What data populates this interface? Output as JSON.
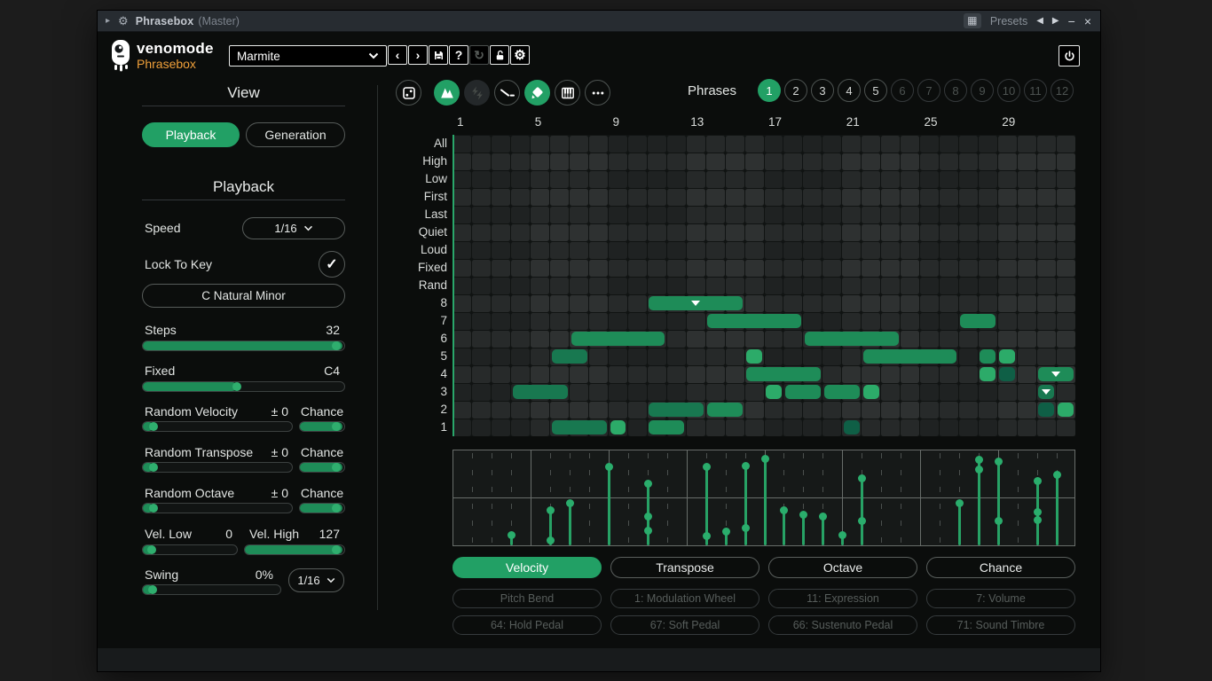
{
  "titlebar": {
    "title": "Phrasebox",
    "subtitle": "(Master)",
    "presets_label": "Presets"
  },
  "header": {
    "brand": "venomode",
    "product": "Phrasebox",
    "preset_name": "Marmite"
  },
  "icons": {
    "caret": "▸",
    "gear": "⚙",
    "grid": "▦",
    "prev": "◀",
    "next": "▶",
    "minimize": "−",
    "close": "×",
    "chev_left": "‹",
    "chev_right": "›",
    "help": "?",
    "reload": "↻",
    "check": "✓",
    "dots": "•••"
  },
  "sidebar": {
    "view_title": "View",
    "view_tabs": [
      {
        "label": "Playback",
        "active": true
      },
      {
        "label": "Generation",
        "active": false
      }
    ],
    "section_title": "Playback",
    "speed": {
      "label": "Speed",
      "value": "1/16"
    },
    "lock_label": "Lock To Key",
    "lock_checked": true,
    "key": "C Natural Minor",
    "steps": {
      "label": "Steps",
      "value": "32",
      "fill": 1.0
    },
    "fixed": {
      "label": "Fixed",
      "value": "C4",
      "fill": 0.47
    },
    "randoms": [
      {
        "label": "Random Velocity",
        "value": "± 0",
        "chance_label": "Chance",
        "fill": 0.03,
        "chance_fill": 1.0
      },
      {
        "label": "Random Transpose",
        "value": "± 0",
        "chance_label": "Chance",
        "fill": 0.03,
        "chance_fill": 1.0
      },
      {
        "label": "Random Octave",
        "value": "± 0",
        "chance_label": "Chance",
        "fill": 0.03,
        "chance_fill": 1.0
      }
    ],
    "vel_low": {
      "label": "Vel. Low",
      "value": "0",
      "fill": 0.03
    },
    "vel_high": {
      "label": "Vel. High",
      "value": "127",
      "fill": 1.0
    },
    "swing": {
      "label": "Swing",
      "value": "0%",
      "grid": "1/16",
      "fill": 0.03
    }
  },
  "toolbar_icons": [
    {
      "name": "dice-icon",
      "state": "outline"
    },
    {
      "name": "phrase-icon",
      "state": "green"
    },
    {
      "name": "bolt-cycle-icon",
      "state": "dark"
    },
    {
      "name": "glide-icon",
      "state": "outline"
    },
    {
      "name": "paint-bucket-icon",
      "state": "green"
    },
    {
      "name": "piano-icon",
      "state": "outline"
    },
    {
      "name": "more-icon",
      "state": "outline"
    }
  ],
  "phrases": {
    "label": "Phrases",
    "items": [
      {
        "n": "1",
        "state": "active"
      },
      {
        "n": "2",
        "state": "on"
      },
      {
        "n": "3",
        "state": "on"
      },
      {
        "n": "4",
        "state": "on"
      },
      {
        "n": "5",
        "state": "on"
      },
      {
        "n": "6",
        "state": "dim"
      },
      {
        "n": "7",
        "state": "dim"
      },
      {
        "n": "8",
        "state": "dim"
      },
      {
        "n": "9",
        "state": "dim"
      },
      {
        "n": "10",
        "state": "dim"
      },
      {
        "n": "11",
        "state": "dim"
      },
      {
        "n": "12",
        "state": "dim"
      }
    ]
  },
  "grid": {
    "col_numbers": [
      1,
      5,
      9,
      13,
      17,
      21,
      25,
      29
    ],
    "row_labels": [
      "All",
      "High",
      "Low",
      "First",
      "Last",
      "Quiet",
      "Loud",
      "Fixed",
      "Rand",
      "8",
      "7",
      "6",
      "5",
      "4",
      "3",
      "2",
      "1"
    ],
    "notes": [
      {
        "row": 8,
        "c1": 11,
        "c2": 15,
        "shade": "med",
        "marker": true
      },
      {
        "row": 7,
        "c1": 14,
        "c2": 18,
        "shade": "med"
      },
      {
        "row": 7,
        "c1": 27,
        "c2": 28,
        "shade": "med"
      },
      {
        "row": 6,
        "c1": 7,
        "c2": 11,
        "shade": "med"
      },
      {
        "row": 6,
        "c1": 19,
        "c2": 23,
        "shade": "med"
      },
      {
        "row": 5,
        "c1": 6,
        "c2": 7,
        "shade": "meddark"
      },
      {
        "row": 5,
        "c1": 16,
        "c2": 16,
        "shade": "bright"
      },
      {
        "row": 5,
        "c1": 22,
        "c2": 26,
        "shade": "med"
      },
      {
        "row": 5,
        "c1": 28,
        "c2": 28,
        "shade": "med"
      },
      {
        "row": 5,
        "c1": 29,
        "c2": 29,
        "shade": "bright"
      },
      {
        "row": 4,
        "c1": 16,
        "c2": 19,
        "shade": "med"
      },
      {
        "row": 4,
        "c1": 28,
        "c2": 28,
        "shade": "bright"
      },
      {
        "row": 4,
        "c1": 29,
        "c2": 29,
        "shade": "dark"
      },
      {
        "row": 4,
        "c1": 31,
        "c2": 32,
        "shade": "med",
        "marker": true
      },
      {
        "row": 3,
        "c1": 4,
        "c2": 6,
        "shade": "meddark"
      },
      {
        "row": 3,
        "c1": 17,
        "c2": 17,
        "shade": "bright"
      },
      {
        "row": 3,
        "c1": 18,
        "c2": 19,
        "shade": "med"
      },
      {
        "row": 3,
        "c1": 20,
        "c2": 21,
        "shade": "med"
      },
      {
        "row": 3,
        "c1": 22,
        "c2": 22,
        "shade": "bright"
      },
      {
        "row": 3,
        "c1": 31,
        "c2": 31,
        "shade": "meddark",
        "marker": true
      },
      {
        "row": 2,
        "c1": 11,
        "c2": 13,
        "shade": "meddark"
      },
      {
        "row": 2,
        "c1": 14,
        "c2": 15,
        "shade": "med"
      },
      {
        "row": 2,
        "c1": 31,
        "c2": 31,
        "shade": "dark"
      },
      {
        "row": 2,
        "c1": 32,
        "c2": 32,
        "shade": "bright"
      },
      {
        "row": 1,
        "c1": 6,
        "c2": 8,
        "shade": "meddark"
      },
      {
        "row": 1,
        "c1": 9,
        "c2": 9,
        "shade": "bright"
      },
      {
        "row": 1,
        "c1": 11,
        "c2": 12,
        "shade": "med"
      },
      {
        "row": 1,
        "c1": 21,
        "c2": 21,
        "shade": "dark"
      }
    ]
  },
  "velocity_lane": {
    "stems": [
      {
        "col": 4,
        "values": [
          14
        ]
      },
      {
        "col": 6,
        "values": [
          48,
          6
        ]
      },
      {
        "col": 7,
        "values": [
          58
        ]
      },
      {
        "col": 9,
        "values": [
          108
        ]
      },
      {
        "col": 11,
        "values": [
          85,
          40,
          20
        ]
      },
      {
        "col": 14,
        "values": [
          109,
          12
        ]
      },
      {
        "col": 15,
        "values": [
          19
        ]
      },
      {
        "col": 16,
        "values": [
          110,
          24
        ]
      },
      {
        "col": 17,
        "values": [
          120
        ]
      },
      {
        "col": 18,
        "values": [
          48
        ]
      },
      {
        "col": 19,
        "values": [
          42
        ]
      },
      {
        "col": 20,
        "values": [
          40
        ]
      },
      {
        "col": 21,
        "values": [
          14
        ]
      },
      {
        "col": 22,
        "values": [
          93,
          33
        ]
      },
      {
        "col": 27,
        "values": [
          58
        ]
      },
      {
        "col": 28,
        "values": [
          118,
          105
        ]
      },
      {
        "col": 29,
        "values": [
          116,
          33
        ]
      },
      {
        "col": 31,
        "values": [
          89,
          46,
          34
        ]
      },
      {
        "col": 32,
        "values": [
          98
        ]
      }
    ]
  },
  "lane_tabs": [
    {
      "label": "Velocity",
      "active": true
    },
    {
      "label": "Transpose",
      "active": false
    },
    {
      "label": "Octave",
      "active": false
    },
    {
      "label": "Chance",
      "active": false
    }
  ],
  "midi_rows": [
    [
      "Pitch Bend",
      "1: Modulation Wheel",
      "11: Expression",
      "7: Volume"
    ],
    [
      "64: Hold Pedal",
      "67: Soft Pedal",
      "66: Sustenuto Pedal",
      "71: Sound Timbre"
    ]
  ],
  "colors": {
    "accent": "#22a065",
    "note_med": "#1e8c58",
    "note_bright": "#2cab69",
    "note_dark": "#0f5f46"
  }
}
